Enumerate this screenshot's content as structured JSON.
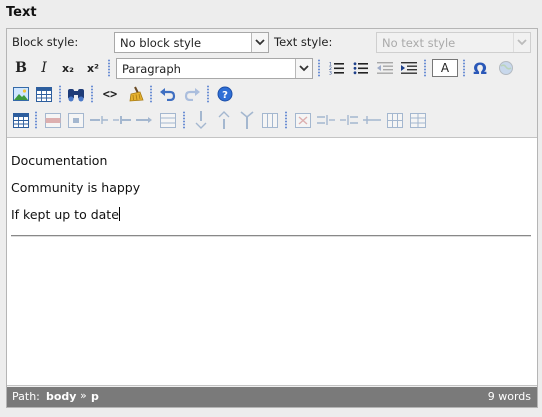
{
  "field": {
    "label": "Text"
  },
  "toolbar": {
    "block_style": {
      "label": "Block style:",
      "value": "No block style"
    },
    "text_style": {
      "label": "Text style:",
      "value": "No text style",
      "disabled": true
    },
    "format": {
      "value": "Paragraph"
    },
    "buttons": {
      "bold": "B",
      "italic": "I",
      "subscript": "x₂",
      "superscript": "x²",
      "forecolor": "A",
      "charmap": "Ω",
      "source": "<>"
    }
  },
  "content": {
    "paragraphs": [
      "Documentation",
      "Community is happy",
      "If kept up to date"
    ]
  },
  "status": {
    "path_label": "Path:",
    "path": [
      "body",
      "p"
    ],
    "path_separator": "»",
    "word_count": "9 words"
  },
  "colors": {
    "background": "#ededed",
    "statusbar": "#7a7a7a",
    "separator_dots": "#6c8fd4",
    "help_icon": "#2f6fd6"
  }
}
